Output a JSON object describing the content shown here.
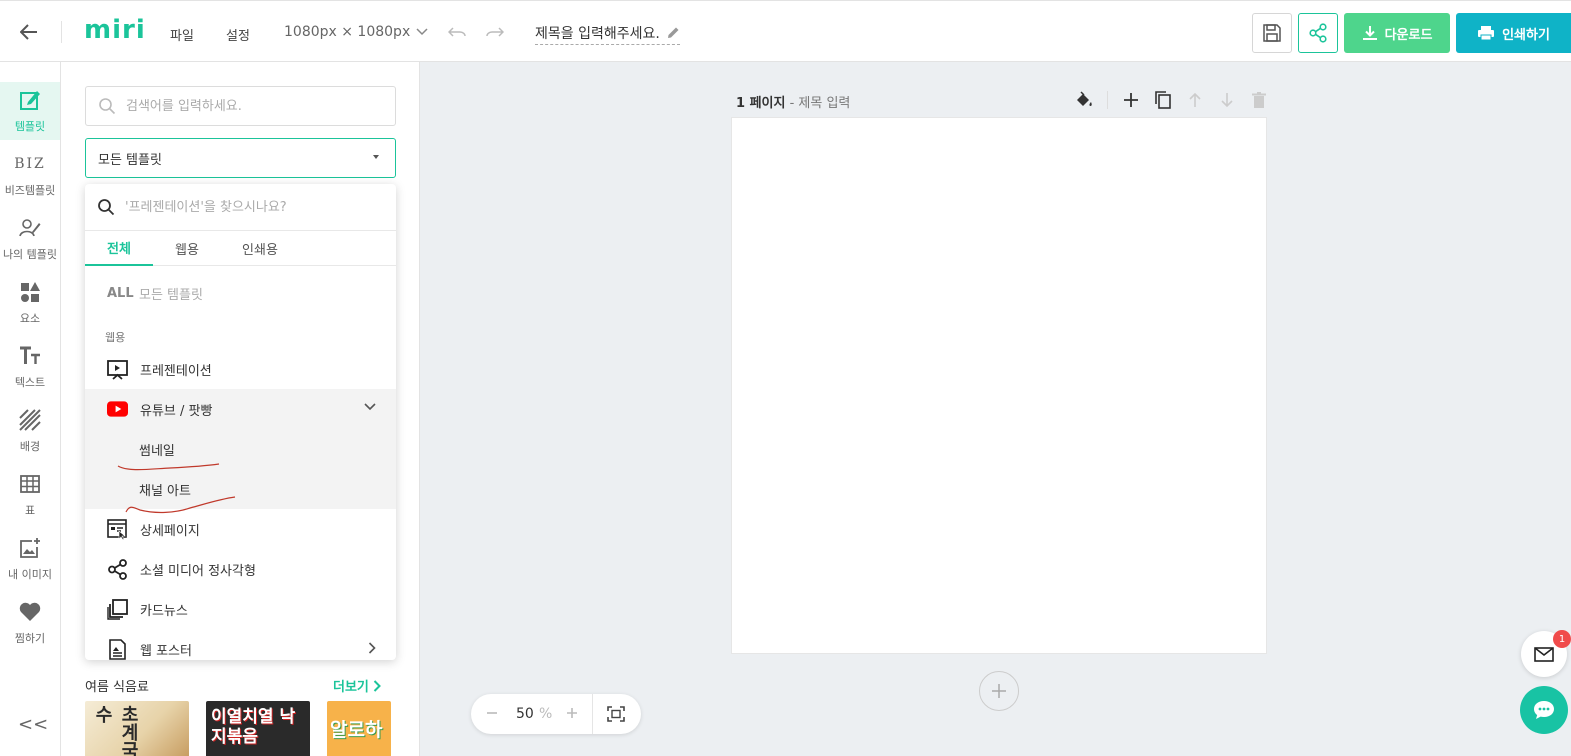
{
  "header": {
    "logo": "miri",
    "menu": [
      "파일",
      "설정"
    ],
    "canvas_size": "1080px × 1080px",
    "title": "제목을 입력해주세요.",
    "download_label": "다운로드",
    "print_label": "인쇄하기"
  },
  "sidebar": {
    "items": [
      {
        "label": "템플릿",
        "icon": "edit-template-icon",
        "active": true
      },
      {
        "label": "비즈템플릿",
        "icon": "biz-icon",
        "glyph": "BIZ"
      },
      {
        "label": "나의 템플릿",
        "icon": "my-template-icon"
      },
      {
        "label": "요소",
        "icon": "shapes-icon"
      },
      {
        "label": "텍스트",
        "icon": "text-icon",
        "glyph": "Tт"
      },
      {
        "label": "배경",
        "icon": "background-icon"
      },
      {
        "label": "표",
        "icon": "table-icon"
      },
      {
        "label": "내 이미지",
        "icon": "add-image-icon"
      },
      {
        "label": "찜하기",
        "icon": "heart-icon"
      }
    ],
    "collapse_glyph": "<<"
  },
  "panel": {
    "search_placeholder": "검색어를 입력하세요.",
    "category_selected": "모든 템플릿",
    "section_title": "여름 식음료",
    "more_label": "더보기",
    "thumbnails": [
      {
        "text": "초계국수"
      },
      {
        "text": "이열치열 낙지볶음"
      },
      {
        "text": "알로하"
      }
    ]
  },
  "dropdown": {
    "search_placeholder": "'프레젠테이션'을 찾으시나요?",
    "tabs": [
      {
        "label": "전체",
        "active": true
      },
      {
        "label": "웹용"
      },
      {
        "label": "인쇄용"
      }
    ],
    "all_tag": "ALL",
    "all_label": "모든 템플릿",
    "group_label": "웹용",
    "items": [
      {
        "label": "프레젠테이션",
        "icon": "presentation-icon"
      },
      {
        "label": "유튜브 / 팟빵",
        "icon": "youtube-icon",
        "expanded": true
      },
      {
        "label": "썸네일",
        "sub": true
      },
      {
        "label": "채널 아트",
        "sub": true
      },
      {
        "label": "상세페이지",
        "icon": "detail-page-icon"
      },
      {
        "label": "소셜 미디어 정사각형",
        "icon": "share-icon"
      },
      {
        "label": "카드뉴스",
        "icon": "card-news-icon"
      },
      {
        "label": "웹 포스터",
        "icon": "poster-icon"
      }
    ]
  },
  "canvas": {
    "page_number": "1 페이지",
    "page_title": "제목 입력",
    "zoom_value": "50",
    "zoom_unit": "%"
  },
  "floating": {
    "mail_badge": "1"
  },
  "colors": {
    "brand": "#1bc49a",
    "download": "#4ed58c",
    "print": "#0fb3c7",
    "badge": "#f04b4b"
  }
}
